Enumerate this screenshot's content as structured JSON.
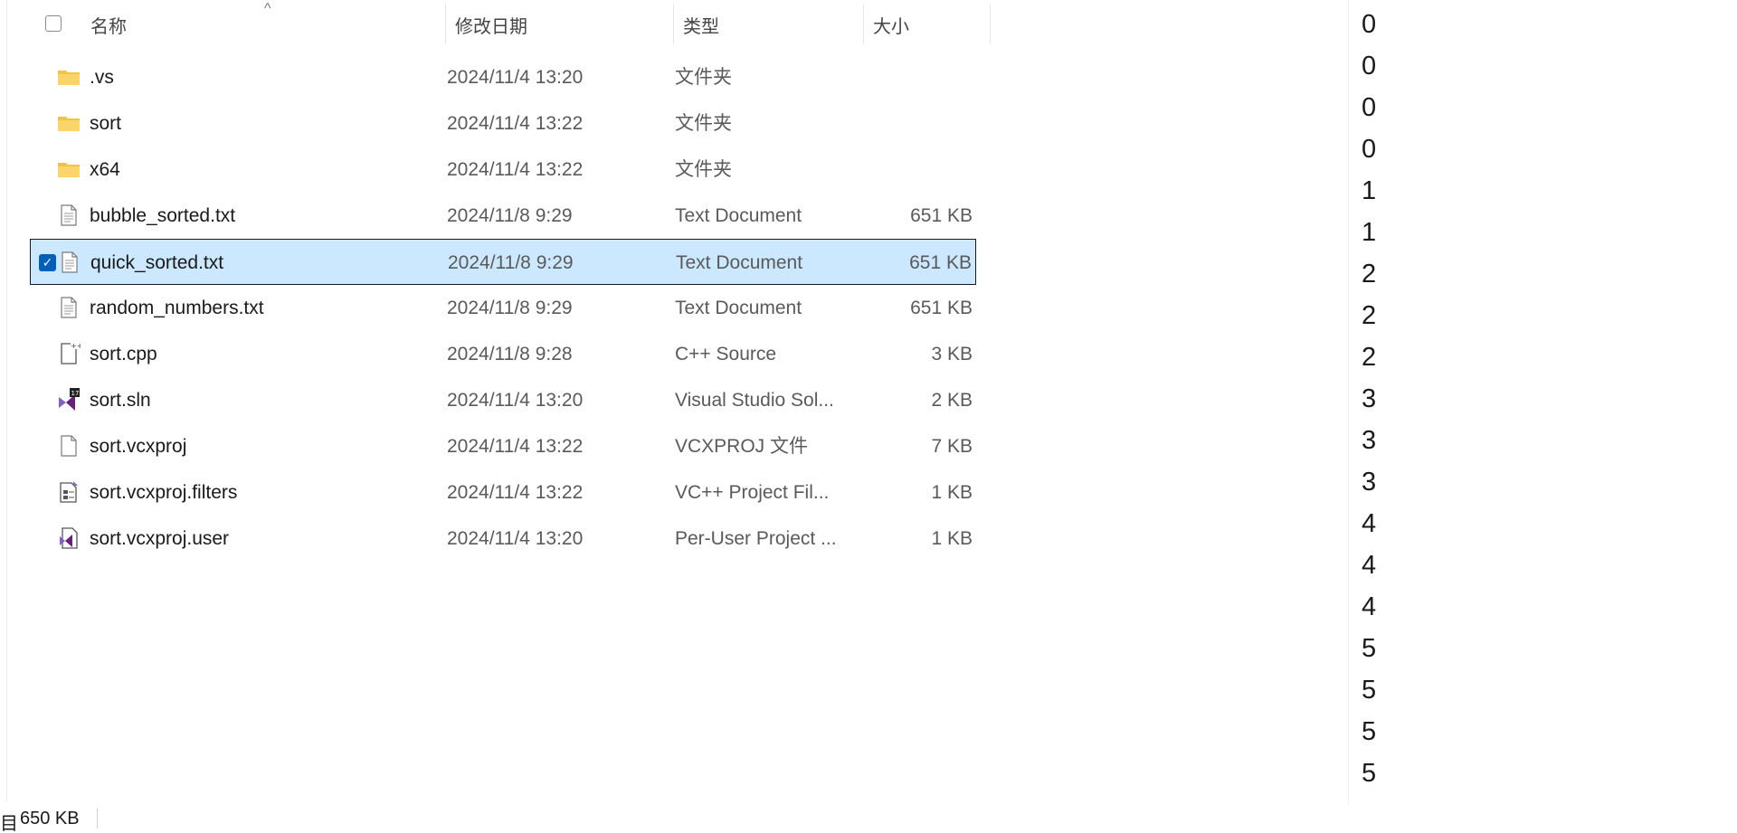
{
  "explorer": {
    "columns": {
      "name": "名称",
      "date": "修改日期",
      "type": "类型",
      "size": "大小"
    },
    "sort_indicator": "^",
    "files": [
      {
        "name": ".vs",
        "date": "2024/11/4 13:20",
        "type": "文件夹",
        "size": "",
        "icon": "folder-icon",
        "selected": false
      },
      {
        "name": "sort",
        "date": "2024/11/4 13:22",
        "type": "文件夹",
        "size": "",
        "icon": "folder-icon",
        "selected": false
      },
      {
        "name": "x64",
        "date": "2024/11/4 13:22",
        "type": "文件夹",
        "size": "",
        "icon": "folder-icon",
        "selected": false
      },
      {
        "name": "bubble_sorted.txt",
        "date": "2024/11/8 9:29",
        "type": "Text Document",
        "size": "651 KB",
        "icon": "text-file-icon",
        "selected": false
      },
      {
        "name": "quick_sorted.txt",
        "date": "2024/11/8 9:29",
        "type": "Text Document",
        "size": "651 KB",
        "icon": "text-file-icon",
        "selected": true
      },
      {
        "name": "random_numbers.txt",
        "date": "2024/11/8 9:29",
        "type": "Text Document",
        "size": "651 KB",
        "icon": "text-file-icon",
        "selected": false
      },
      {
        "name": "sort.cpp",
        "date": "2024/11/8 9:28",
        "type": "C++ Source",
        "size": "3 KB",
        "icon": "cpp-file-icon",
        "selected": false
      },
      {
        "name": "sort.sln",
        "date": "2024/11/4 13:20",
        "type": "Visual Studio Sol...",
        "size": "2 KB",
        "icon": "visual-studio-solution-icon",
        "selected": false
      },
      {
        "name": "sort.vcxproj",
        "date": "2024/11/4 13:22",
        "type": "VCXPROJ 文件",
        "size": "7 KB",
        "icon": "blank-file-icon",
        "selected": false
      },
      {
        "name": "sort.vcxproj.filters",
        "date": "2024/11/4 13:22",
        "type": "VC++ Project Fil...",
        "size": "1 KB",
        "icon": "project-filters-icon",
        "selected": false
      },
      {
        "name": "sort.vcxproj.user",
        "date": "2024/11/4 13:20",
        "type": "Per-User Project ...",
        "size": "1 KB",
        "icon": "visual-studio-user-icon",
        "selected": false
      }
    ],
    "status": {
      "count_fragment": "目",
      "selected_size": "650 KB"
    }
  },
  "numbers_view": {
    "lines": [
      "0",
      "0",
      "0",
      "0",
      "1",
      "1",
      "2",
      "2",
      "2",
      "3",
      "3",
      "3",
      "4",
      "4",
      "4",
      "5",
      "5",
      "5",
      "5"
    ]
  },
  "colors": {
    "selection_fill": "#cce8ff",
    "checkbox_accent": "#005fb8",
    "folder_yellow": "#f5c343"
  }
}
